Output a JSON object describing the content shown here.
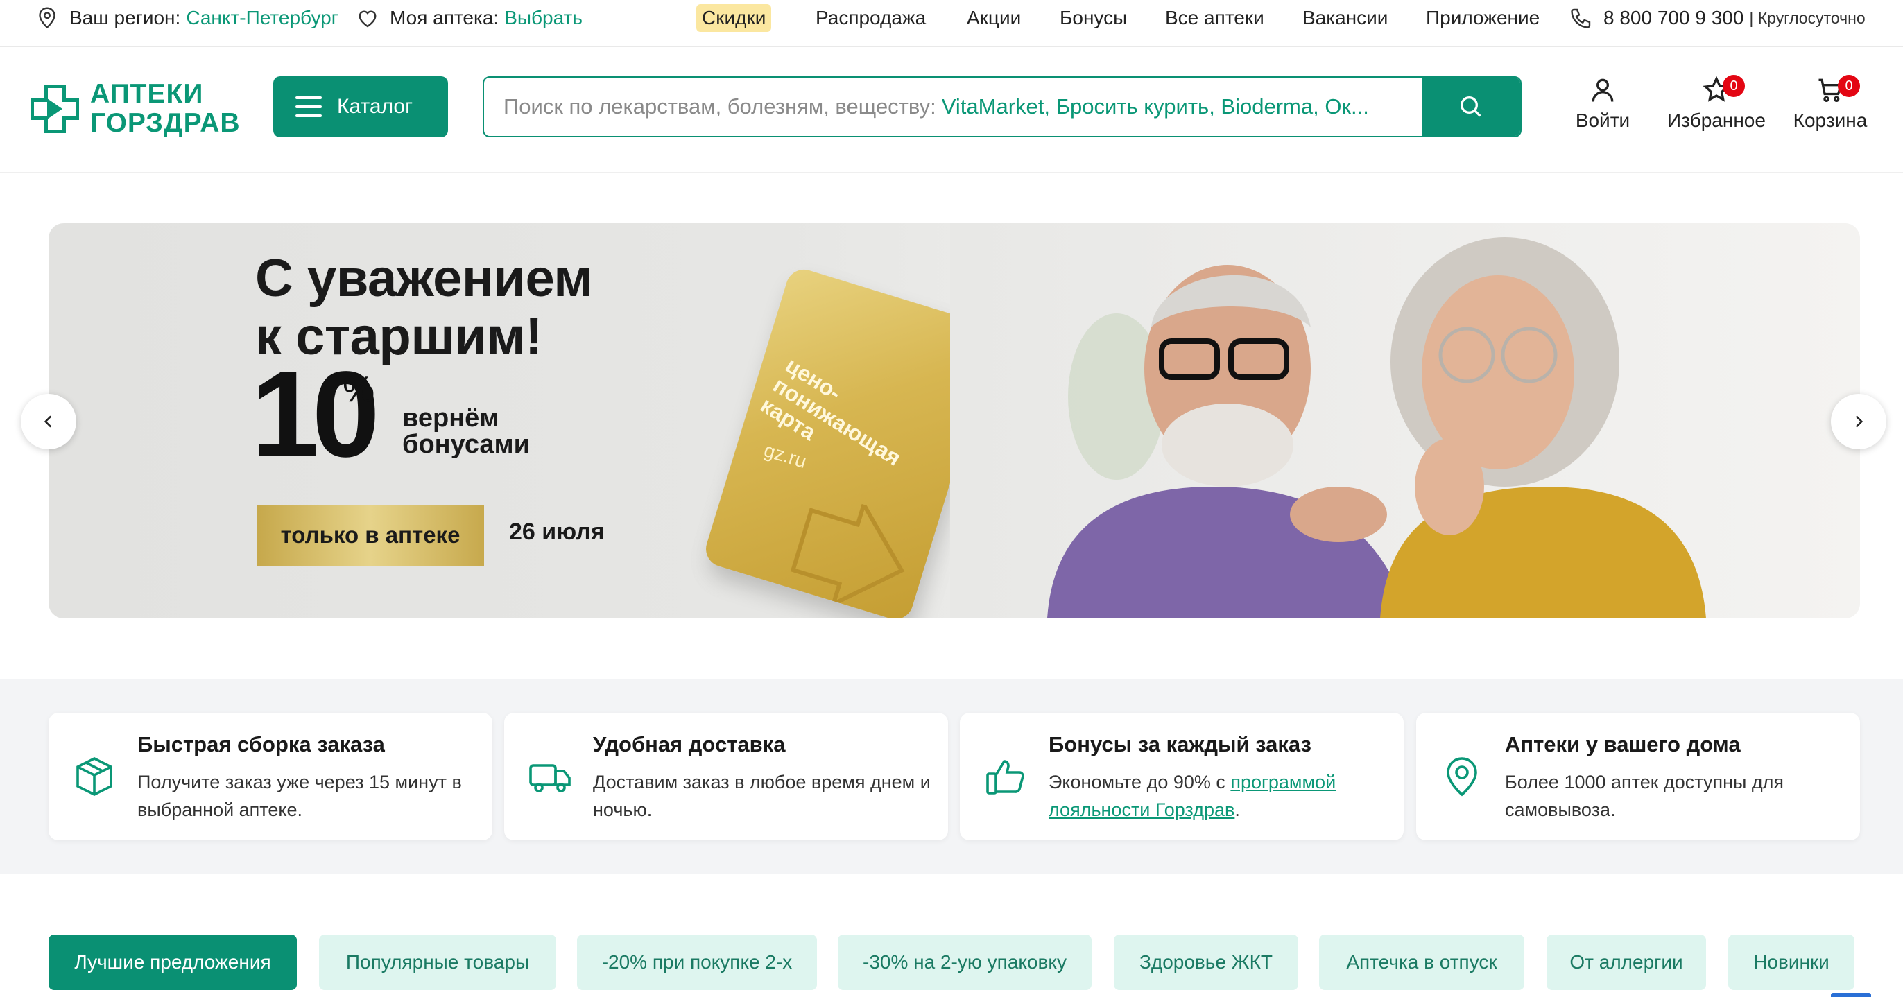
{
  "topbar": {
    "region_label": "Ваш регион:",
    "region_value": "Санкт-Петербург",
    "pharmacy_label": "Моя аптека:",
    "pharmacy_value": "Выбрать",
    "links": [
      "Скидки",
      "Распродажа",
      "Акции",
      "Бонусы",
      "Все аптеки",
      "Вакансии",
      "Приложение"
    ],
    "phone": "8 800 700 9 300",
    "phone_note": "| Круглосуточно"
  },
  "header": {
    "logo_line1": "АПТЕКИ",
    "logo_line2": "ГОРЗДРАВ",
    "catalog_label": "Каталог",
    "search": {
      "placeholder": "Поиск по лекарствам, болезням, веществу:",
      "suggestions": "VitaMarket, Бросить курить, Bioderma, Ок..."
    },
    "actions": {
      "login": "Войти",
      "favorites": "Избранное",
      "favorites_count": "0",
      "cart": "Корзина",
      "cart_count": "0"
    }
  },
  "banner": {
    "title_line1": "С уважением",
    "title_line2": "к старшим!",
    "big_number": "10",
    "percent": "%",
    "cashback_line1": "вернём",
    "cashback_line2": "бонусами",
    "only_label": "только в аптеке",
    "date": "26 июля",
    "card_text_line1": "цено-",
    "card_text_line2": "понижающая",
    "card_text_line3": "карта",
    "card_site": "gz.ru"
  },
  "features": [
    {
      "icon": "box-icon",
      "title": "Быстрая сборка заказа",
      "text": "Получите заказ уже через 15 минут в выбранной аптеке."
    },
    {
      "icon": "truck-icon",
      "title": "Удобная доставка",
      "text": "Доставим заказ в любое время днем и ночью."
    },
    {
      "icon": "thumbs-up-icon",
      "title": "Бонусы за каждый заказ",
      "text_before": "Экономьте до 90% с ",
      "link": "программой лояльности Горздрав",
      "text_after": "."
    },
    {
      "icon": "location-pin-icon",
      "title": "Аптеки у вашего дома",
      "text": "Более 1000 аптек доступны для самовывоза."
    }
  ],
  "tabs": [
    "Лучшие предложения",
    "Популярные товары",
    "-20% при покупке 2-х",
    "-30% на 2-ую упаковку",
    "Здоровье ЖКТ",
    "Аптечка в отпуск",
    "От аллергии",
    "Новинки"
  ],
  "colors": {
    "brand_green": "#0a9073",
    "accent_text": "#0a9776",
    "chip_bg": "#def5ef",
    "badge_red": "#e30613",
    "highlight": "#fbe7a0"
  }
}
